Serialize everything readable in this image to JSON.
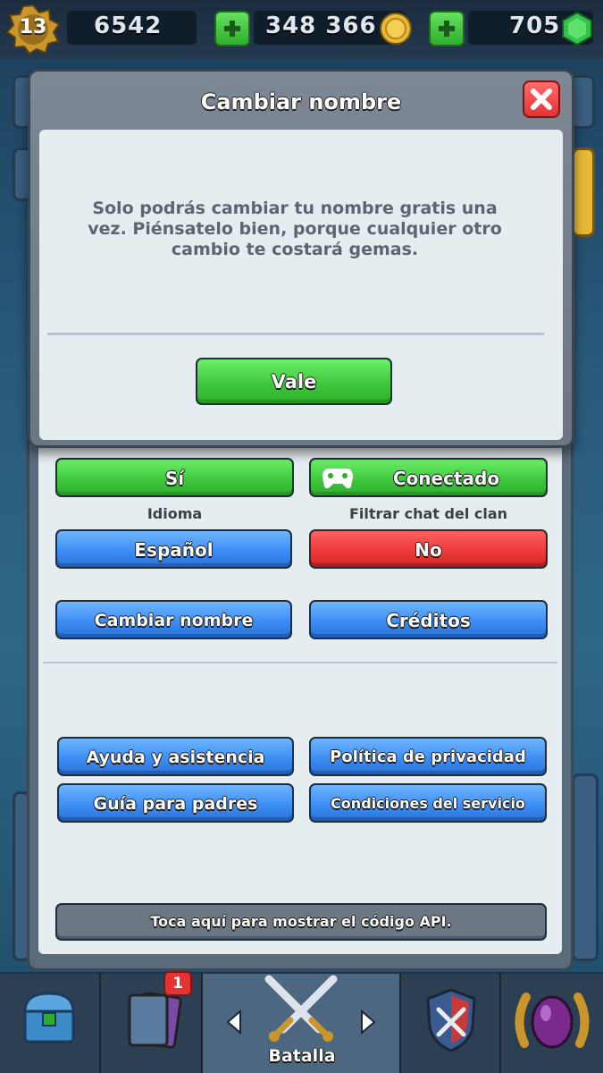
{
  "topbar": {
    "level": "13",
    "trophies": "6542",
    "gold": "348 366",
    "gems": "705"
  },
  "modal": {
    "title": "Cambiar nombre",
    "message": "Solo podrás cambiar tu nombre gratis una vez. Piénsatelo bien, porque cualquier otro cambio te costará gemas.",
    "ok_label": "Vale"
  },
  "settings": {
    "row1_left": "Sí",
    "row1_right": "Conectado",
    "language_label": "Idioma",
    "language_value": "Español",
    "clan_filter_label": "Filtrar chat del clan",
    "clan_filter_value": "No",
    "change_name": "Cambiar nombre",
    "credits": "Créditos",
    "help": "Ayuda y asistencia",
    "privacy": "Política de privacidad",
    "parents": "Guía para padres",
    "terms": "Condiciones del servicio",
    "api_code": "Toca aquí para mostrar el código API."
  },
  "nav": {
    "active_label": "Batalla",
    "cards_badge": "1"
  },
  "colors": {
    "green": "#3fc83d",
    "blue": "#3d8ef4",
    "red": "#ee3b3b",
    "gold": "#e8b934",
    "gem": "#35c24a"
  },
  "icons": [
    "level-badge-icon",
    "trophy-icon",
    "gold-coin-icon",
    "gem-icon",
    "plus-icon",
    "close-icon",
    "gamepad-icon",
    "chest-icon",
    "cards-icon",
    "crossed-swords-icon",
    "clan-shield-icon",
    "events-laurel-icon",
    "chevron-left-icon",
    "chevron-right-icon"
  ]
}
